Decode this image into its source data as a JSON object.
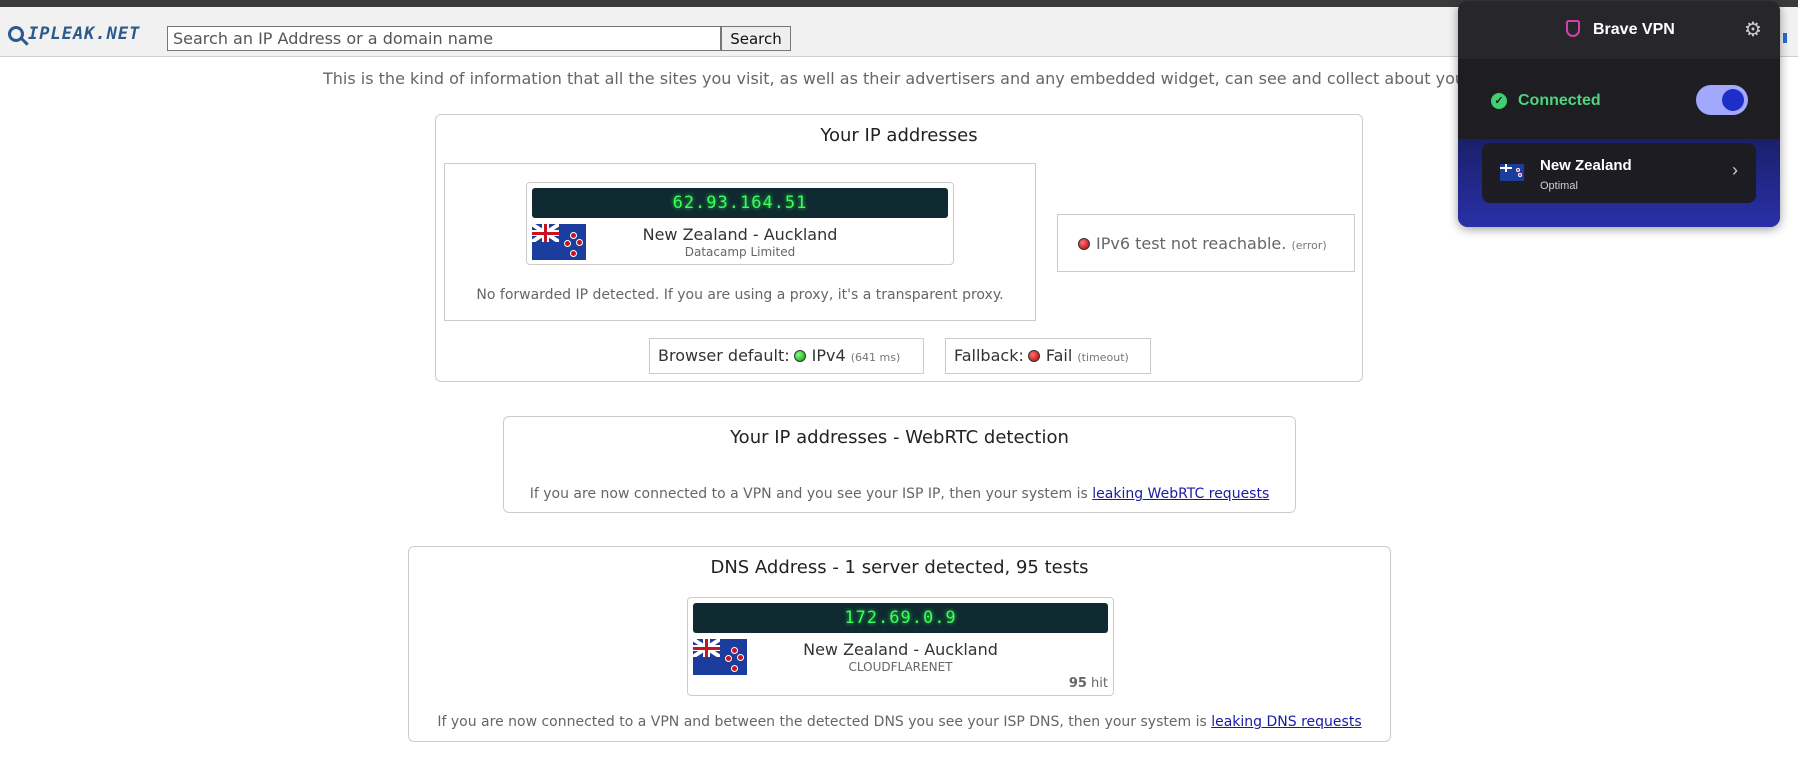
{
  "header": {
    "logo_text": "IPLEAK.NET",
    "search_placeholder": "Search an IP Address or a domain name",
    "search_button": "Search"
  },
  "intro_text": "This is the kind of information that all the sites you visit, as well as their advertisers and any embedded widget, can see and collect about you.",
  "ip_section": {
    "title": "Your IP addresses",
    "ipv4": {
      "address": "62.93.164.51",
      "location": "New Zealand - Auckland",
      "isp": "Datacamp Limited"
    },
    "forwarded_note": "No forwarded IP detected. If you are using a proxy, it's a transparent proxy.",
    "ipv6": {
      "text": "IPv6 test not reachable.",
      "note": "(error)",
      "status_color": "#cc0000"
    },
    "browser_default": {
      "label": "Browser default:",
      "value": "IPv4",
      "note": "(641 ms)",
      "status_color": "#11aa11"
    },
    "fallback": {
      "label": "Fallback:",
      "value": "Fail",
      "note": "(timeout)",
      "status_color": "#cc0000"
    }
  },
  "webrtc_section": {
    "title": "Your IP addresses - WebRTC detection",
    "note_prefix": "If you are now connected to a VPN and you see your ISP IP, then your system is",
    "link": "leaking WebRTC requests"
  },
  "dns_section": {
    "title": "DNS Address - 1 server detected, 95 tests",
    "server": {
      "address": "172.69.0.9",
      "location": "New Zealand - Auckland",
      "isp": "CLOUDFLARENET",
      "hits": "95",
      "hits_label": "hit"
    },
    "note_prefix": "If you are now connected to a VPN and between the detected DNS you see your ISP DNS, then your system is",
    "link": "leaking DNS requests"
  },
  "vpn_popup": {
    "title": "Brave VPN",
    "status": "Connected",
    "toggle_on": true,
    "country": "New Zealand",
    "server_mode": "Optimal",
    "accent_color": "#4fd47e",
    "icons": [
      "shield-icon",
      "gear-icon",
      "check-icon",
      "chevron-right-icon"
    ]
  }
}
